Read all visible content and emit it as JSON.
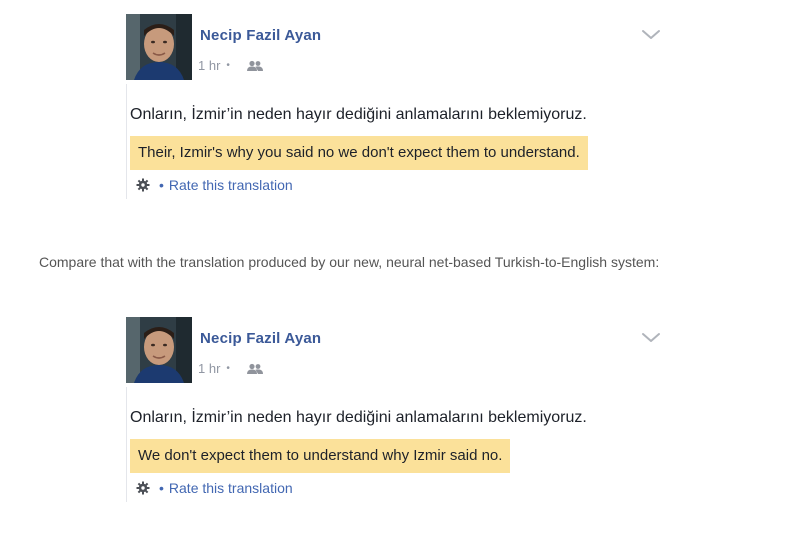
{
  "posts": [
    {
      "author": "Necip Fazil Ayan",
      "time": "1 hr",
      "separator": "•",
      "original_text": "Onların, İzmir’in neden hayır dediğini anlamalarını beklemiyoruz.",
      "translation": "Their, Izmir's why you said no we don't expect them to understand.",
      "rate_separator": "•",
      "rate_label": "Rate this translation"
    },
    {
      "author": "Necip Fazil Ayan",
      "time": "1 hr",
      "separator": "•",
      "original_text": "Onların, İzmir’in neden hayır dediğini anlamalarını beklemiyoruz.",
      "translation": "We don't expect them to understand why Izmir said no.",
      "rate_separator": "•",
      "rate_label": "Rate this translation"
    }
  ],
  "caption": "Compare that with the translation produced by our new, neural net-based Turkish-to-English system:",
  "icons": {
    "audience": "friends-icon",
    "menu": "chevron-down-icon",
    "settings": "gear-icon"
  },
  "colors": {
    "author": "#3b5998",
    "link": "#4267b2",
    "highlight": "#fbe19a",
    "meta": "#9197a3",
    "text": "#1d2129",
    "caption": "#555555"
  }
}
